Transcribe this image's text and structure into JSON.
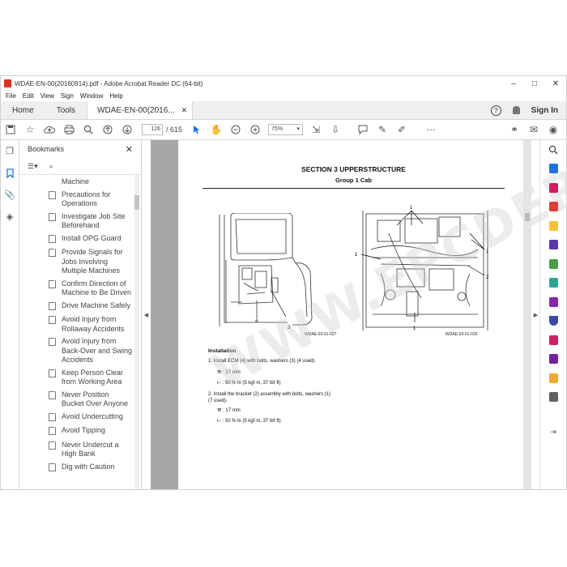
{
  "window": {
    "title": "WDAE-EN-00(20160914).pdf - Adobe Acrobat Reader DC (64-bit)",
    "controls": [
      "–",
      "□",
      "✕"
    ]
  },
  "menu": [
    "File",
    "Edit",
    "View",
    "Sign",
    "Window",
    "Help"
  ],
  "tabs": {
    "home": "Home",
    "tools": "Tools",
    "doc": "WDAE-EN-00(2016...",
    "close": "✕",
    "sign_in": "Sign In"
  },
  "toolbar": {
    "current_page": "126",
    "total_pages": "/ 615",
    "zoom": "75%"
  },
  "bookmarks": {
    "title": "Bookmarks",
    "close": "✕",
    "items": [
      "Machine",
      "Precautions for Operations",
      "Investigate Job Site Beforehand",
      "Install OPG Guard",
      "Provide Signals for Jobs Involving Multiple Machines",
      "Confirm Direction of Machine to Be Driven",
      "Drive Machine Safely",
      "Avoid Injury from Rollaway Accidents",
      "Avoid Injury from Back-Over and Swing Accidents",
      "Keep Person Clear from Working Area",
      "Never Position Bucket Over Anyone",
      "Avoid Undercutting",
      "Avoid Tipping",
      "Never Undercut a High Bank",
      "Dig with Caution"
    ]
  },
  "document": {
    "section_title": "SECTION 3 UPPERSTRUCTURE",
    "group_title": "Group 1 Cab",
    "fig_left_caption": "WDAE-03-01-027",
    "fig_right_caption": "WDAE-03-01-026",
    "fig_left_labels": [
      "4",
      "3"
    ],
    "fig_right_labels": [
      "1",
      "1",
      "1",
      "2",
      "1"
    ],
    "installation_heading": "Installation",
    "step1": "1.  Install ECM (4) with bolts, washers (3) (4 used).",
    "step1_spec1": ": 17 mm",
    "step1_spec2": ": 50 N·m (5 kgf·m, 37 lbf·ft)",
    "step2": "2.  Install the bracket (2) assembly with bolts, washers (1) (7 used).",
    "step2_spec1": ": 17 mm",
    "step2_spec2": ": 50 N·m (5 kgf·m, 37 lbf·ft)",
    "watermark": "WWW.EPCDERO.COM"
  },
  "colors": {
    "accent_blue": "#1a73e8",
    "pdf_red": "#d32f2f",
    "doc_bg": "#a7a7a7"
  },
  "rightrail_icons": [
    "search-icon",
    "export-pdf-icon",
    "organize-icon",
    "create-pdf-icon",
    "comment-icon",
    "combine-icon",
    "compress-icon",
    "edit-icon",
    "fill-sign-icon",
    "protect-icon",
    "export-icon",
    "sign-icon",
    "stamp-icon",
    "more-tools-icon"
  ]
}
